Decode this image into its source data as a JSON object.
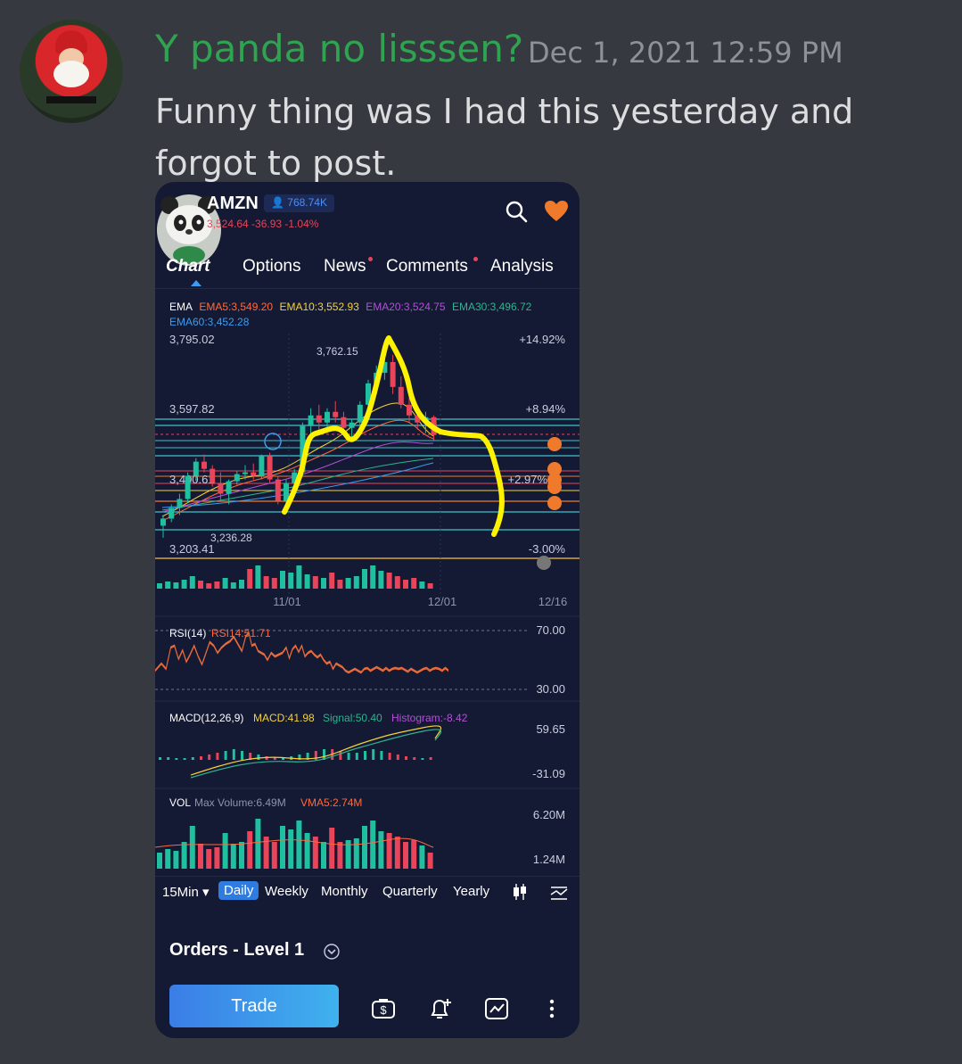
{
  "message": {
    "username": "Y panda no lisssen?",
    "timestamp": "Dec 1, 2021 12:59 PM",
    "text": "Funny thing was I had this yesterday and forgot to post."
  },
  "app": {
    "ticker": "AMZN",
    "followers": "768.74K",
    "quote": "3,524.64 -36.93 -1.04%",
    "tabs": [
      "Chart",
      "Options",
      "News",
      "Comments",
      "Analysis"
    ],
    "active_tab": "Chart",
    "ema_legend": {
      "title": "EMA",
      "ema5": "EMA5:3,549.20",
      "ema10": "EMA10:3,552.93",
      "ema20": "EMA20:3,524.75",
      "ema30": "EMA30:3,496.72",
      "ema60": "EMA60:3,452.28"
    },
    "price_labels": {
      "high_axis": "3,795.02",
      "high_pct": "+14.92%",
      "peak": "3,762.15",
      "mid_axis": "3,597.82",
      "mid_pct": "+8.94%",
      "low_mid_axis": "3,400.61",
      "low_mid_pct": "+2.97%",
      "low_marker": "3,236.28",
      "low_axis": "3,203.41",
      "low_pct": "-3.00%"
    },
    "date_labels": [
      "11/01",
      "12/01",
      "12/16"
    ],
    "rsi": {
      "title": "RSI(14)",
      "value": "RSI14:51.71",
      "upper": "70.00",
      "lower": "30.00"
    },
    "macd": {
      "title": "MACD(12,26,9)",
      "macd": "MACD:41.98",
      "signal": "Signal:50.40",
      "histogram": "Histogram:-8.42",
      "upper": "59.65",
      "lower": "-31.09"
    },
    "vol": {
      "title": "VOL",
      "max": "Max Volume:6.49M",
      "vma": "VMA5:2.74M",
      "upper": "6.20M",
      "lower": "1.24M"
    },
    "periods": [
      "15Min ▾",
      "Daily",
      "Weekly",
      "Monthly",
      "Quarterly",
      "Yearly"
    ],
    "active_period": "Daily",
    "orders_title": "Orders - Level 1",
    "trade_label": "Trade"
  },
  "colors": {
    "username": "#2fa34f",
    "up_candle": "#1fbfa0",
    "down_candle": "#e8445a",
    "ema5": "#ff6a3d",
    "ema10": "#f5d13a",
    "ema20": "#b44fd6",
    "ema30": "#2fb38f",
    "ema60": "#3b9cf2",
    "drawing": "#fff200",
    "heart": "#f07a2c"
  },
  "chart_data": {
    "type": "candlestick",
    "ticker": "AMZN",
    "x_ticks": [
      "11/01",
      "12/01",
      "12/16"
    ],
    "price_range": [
      3203.41,
      3795.02
    ],
    "price_ticks": [
      3795.02,
      3597.82,
      3400.61,
      3203.41
    ],
    "pct_ticks": [
      "+14.92%",
      "+8.94%",
      "+2.97%",
      "-3.00%"
    ],
    "annotated_high": 3762.15,
    "annotated_low": 3236.28,
    "candles": [
      {
        "o": 3270,
        "h": 3300,
        "l": 3236,
        "c": 3290
      },
      {
        "o": 3290,
        "h": 3330,
        "l": 3280,
        "c": 3320
      },
      {
        "o": 3320,
        "h": 3360,
        "l": 3300,
        "c": 3345
      },
      {
        "o": 3345,
        "h": 3420,
        "l": 3335,
        "c": 3410
      },
      {
        "o": 3410,
        "h": 3460,
        "l": 3395,
        "c": 3450
      },
      {
        "o": 3450,
        "h": 3470,
        "l": 3420,
        "c": 3430
      },
      {
        "o": 3430,
        "h": 3440,
        "l": 3380,
        "c": 3390
      },
      {
        "o": 3390,
        "h": 3420,
        "l": 3340,
        "c": 3360
      },
      {
        "o": 3360,
        "h": 3400,
        "l": 3330,
        "c": 3395
      },
      {
        "o": 3395,
        "h": 3425,
        "l": 3385,
        "c": 3415
      },
      {
        "o": 3415,
        "h": 3440,
        "l": 3400,
        "c": 3420
      },
      {
        "o": 3420,
        "h": 3445,
        "l": 3400,
        "c": 3410
      },
      {
        "o": 3410,
        "h": 3470,
        "l": 3400,
        "c": 3465
      },
      {
        "o": 3465,
        "h": 3475,
        "l": 3390,
        "c": 3400
      },
      {
        "o": 3400,
        "h": 3410,
        "l": 3330,
        "c": 3340
      },
      {
        "o": 3340,
        "h": 3400,
        "l": 3320,
        "c": 3390
      },
      {
        "o": 3390,
        "h": 3430,
        "l": 3370,
        "c": 3420
      },
      {
        "o": 3420,
        "h": 3560,
        "l": 3410,
        "c": 3550
      },
      {
        "o": 3550,
        "h": 3600,
        "l": 3520,
        "c": 3580
      },
      {
        "o": 3580,
        "h": 3610,
        "l": 3540,
        "c": 3560
      },
      {
        "o": 3560,
        "h": 3600,
        "l": 3530,
        "c": 3590
      },
      {
        "o": 3590,
        "h": 3620,
        "l": 3560,
        "c": 3575
      },
      {
        "o": 3575,
        "h": 3590,
        "l": 3530,
        "c": 3545
      },
      {
        "o": 3545,
        "h": 3570,
        "l": 3520,
        "c": 3560
      },
      {
        "o": 3560,
        "h": 3620,
        "l": 3550,
        "c": 3610
      },
      {
        "o": 3610,
        "h": 3680,
        "l": 3600,
        "c": 3670
      },
      {
        "o": 3670,
        "h": 3720,
        "l": 3640,
        "c": 3700
      },
      {
        "o": 3700,
        "h": 3762,
        "l": 3680,
        "c": 3730
      },
      {
        "o": 3730,
        "h": 3750,
        "l": 3640,
        "c": 3660
      },
      {
        "o": 3660,
        "h": 3690,
        "l": 3600,
        "c": 3610
      },
      {
        "o": 3610,
        "h": 3640,
        "l": 3560,
        "c": 3580
      },
      {
        "o": 3580,
        "h": 3600,
        "l": 3540,
        "c": 3560
      },
      {
        "o": 3560,
        "h": 3590,
        "l": 3530,
        "c": 3575
      },
      {
        "o": 3575,
        "h": 3580,
        "l": 3510,
        "c": 3525
      }
    ]
  }
}
